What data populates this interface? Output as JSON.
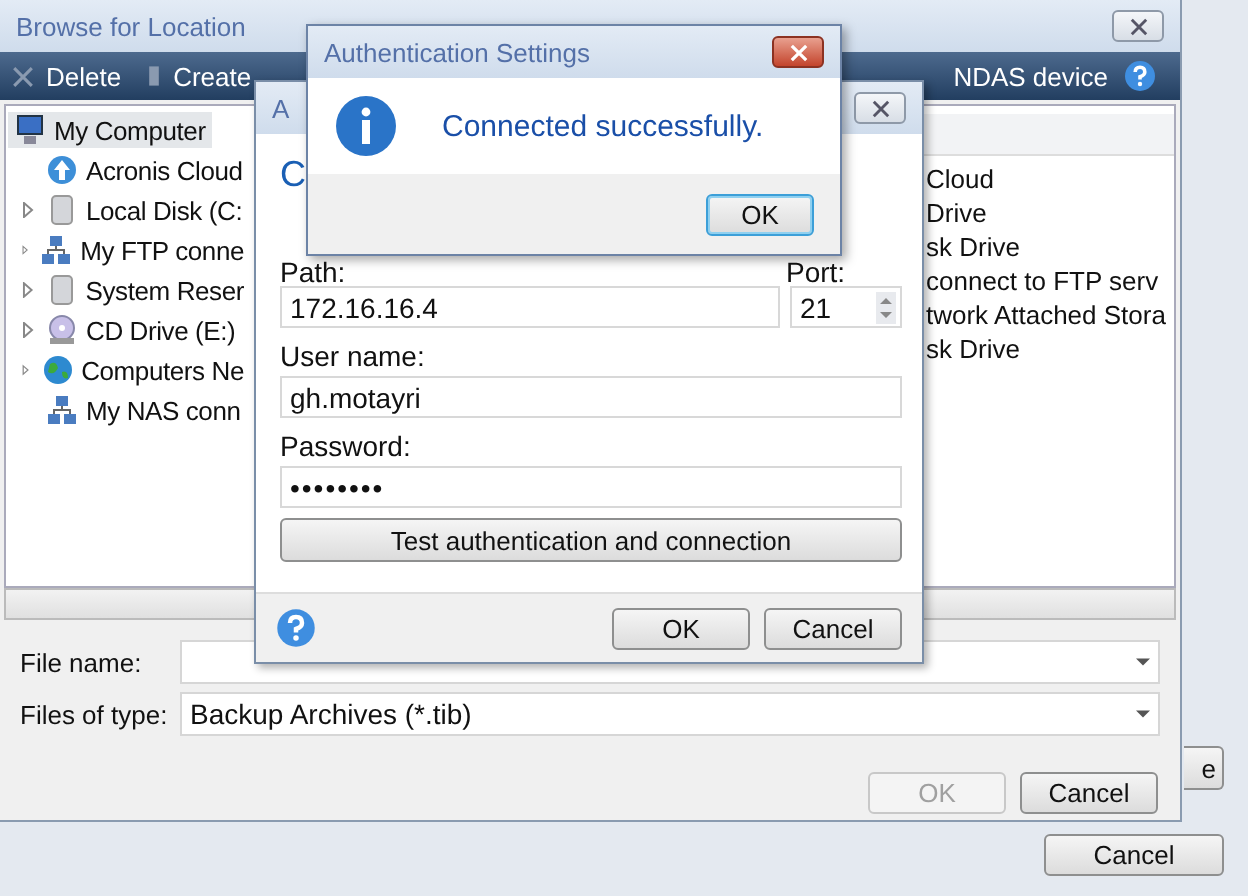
{
  "background_window": {
    "partial_button": "e",
    "cancel_button": "Cancel"
  },
  "browse_window": {
    "title": "Browse for Location",
    "toolbar": [
      {
        "label": "Delete",
        "kind": "delete"
      },
      {
        "label": "Create",
        "kind": "create"
      }
    ],
    "toolbar_right": "NDAS device",
    "tree": [
      {
        "label": "My Computer",
        "kind": "computer",
        "selected": true,
        "children": [
          {
            "label": "Acronis Cloud",
            "kind": "cloud",
            "expandable": false,
            "selected": false
          },
          {
            "label": "Local Disk (C:",
            "kind": "disk",
            "expandable": true,
            "selected": false
          },
          {
            "label": "My FTP conne",
            "kind": "network",
            "expandable": true,
            "selected": false
          },
          {
            "label": "System Reser",
            "kind": "disk",
            "expandable": true,
            "selected": false
          },
          {
            "label": "CD Drive (E:)",
            "kind": "cd",
            "expandable": true,
            "selected": false
          },
          {
            "label": "Computers Ne",
            "kind": "globe",
            "expandable": true,
            "selected": false
          },
          {
            "label": "My NAS conn",
            "kind": "network",
            "expandable": false,
            "selected": false
          }
        ]
      }
    ],
    "list_items": [
      "Cloud",
      "Drive",
      "sk Drive",
      "connect to FTP serv",
      "twork Attached Stora",
      "sk Drive"
    ],
    "file_name": {
      "label": "File name:"
    },
    "file_type": {
      "label": "Files of type:",
      "value": "Backup Archives (*.tib)"
    },
    "buttons": [
      {
        "label": "OK",
        "disabled": true
      },
      {
        "label": "Cancel",
        "disabled": false
      }
    ]
  },
  "settings_dialog": {
    "title": "A",
    "heading": "C",
    "path": {
      "label": "Path:",
      "value": "172.16.16.4"
    },
    "port": {
      "label": "Port:",
      "value": "21"
    },
    "user_name": {
      "label": "User name:",
      "value": "gh.motayri"
    },
    "password": {
      "label": "Password:",
      "value": "••••••••"
    },
    "test_button": "Test authentication and connection",
    "buttons": [
      {
        "label": "OK"
      },
      {
        "label": "Cancel"
      }
    ]
  },
  "message_box": {
    "title": "Authentication Settings",
    "message": "Connected successfully.",
    "button": "OK"
  }
}
